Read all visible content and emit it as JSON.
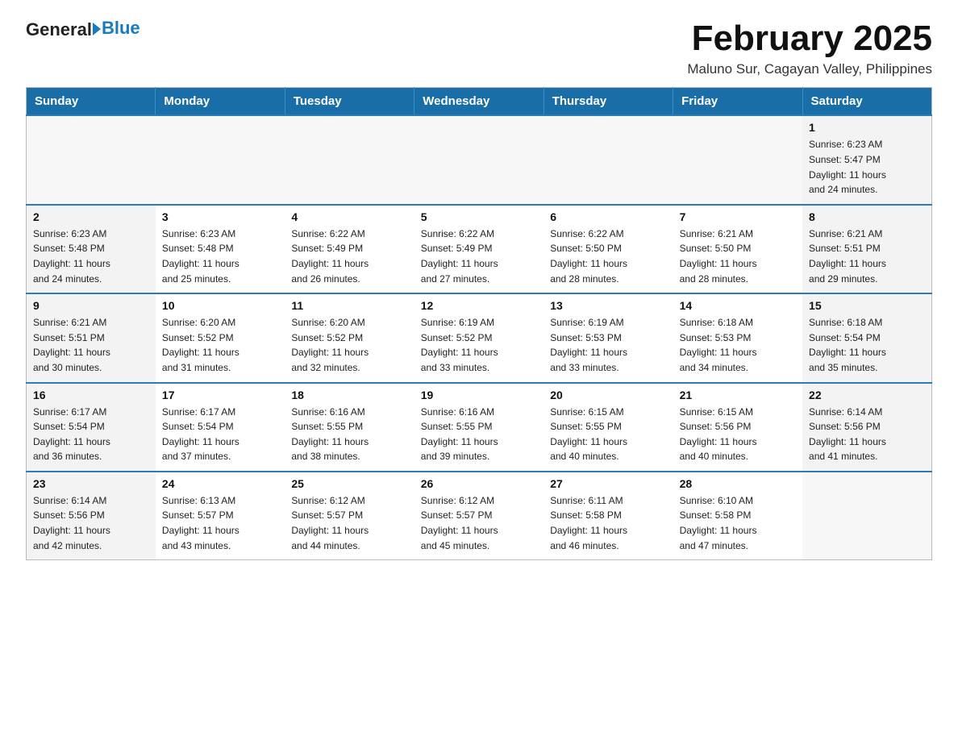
{
  "logo": {
    "text_general": "General",
    "text_blue": "Blue",
    "tagline": "GeneralBlue"
  },
  "header": {
    "month_title": "February 2025",
    "subtitle": "Maluno Sur, Cagayan Valley, Philippines"
  },
  "days_of_week": [
    "Sunday",
    "Monday",
    "Tuesday",
    "Wednesday",
    "Thursday",
    "Friday",
    "Saturday"
  ],
  "weeks": [
    {
      "days": [
        {
          "number": "",
          "info": ""
        },
        {
          "number": "",
          "info": ""
        },
        {
          "number": "",
          "info": ""
        },
        {
          "number": "",
          "info": ""
        },
        {
          "number": "",
          "info": ""
        },
        {
          "number": "",
          "info": ""
        },
        {
          "number": "1",
          "info": "Sunrise: 6:23 AM\nSunset: 5:47 PM\nDaylight: 11 hours\nand 24 minutes."
        }
      ]
    },
    {
      "days": [
        {
          "number": "2",
          "info": "Sunrise: 6:23 AM\nSunset: 5:48 PM\nDaylight: 11 hours\nand 24 minutes."
        },
        {
          "number": "3",
          "info": "Sunrise: 6:23 AM\nSunset: 5:48 PM\nDaylight: 11 hours\nand 25 minutes."
        },
        {
          "number": "4",
          "info": "Sunrise: 6:22 AM\nSunset: 5:49 PM\nDaylight: 11 hours\nand 26 minutes."
        },
        {
          "number": "5",
          "info": "Sunrise: 6:22 AM\nSunset: 5:49 PM\nDaylight: 11 hours\nand 27 minutes."
        },
        {
          "number": "6",
          "info": "Sunrise: 6:22 AM\nSunset: 5:50 PM\nDaylight: 11 hours\nand 28 minutes."
        },
        {
          "number": "7",
          "info": "Sunrise: 6:21 AM\nSunset: 5:50 PM\nDaylight: 11 hours\nand 28 minutes."
        },
        {
          "number": "8",
          "info": "Sunrise: 6:21 AM\nSunset: 5:51 PM\nDaylight: 11 hours\nand 29 minutes."
        }
      ]
    },
    {
      "days": [
        {
          "number": "9",
          "info": "Sunrise: 6:21 AM\nSunset: 5:51 PM\nDaylight: 11 hours\nand 30 minutes."
        },
        {
          "number": "10",
          "info": "Sunrise: 6:20 AM\nSunset: 5:52 PM\nDaylight: 11 hours\nand 31 minutes."
        },
        {
          "number": "11",
          "info": "Sunrise: 6:20 AM\nSunset: 5:52 PM\nDaylight: 11 hours\nand 32 minutes."
        },
        {
          "number": "12",
          "info": "Sunrise: 6:19 AM\nSunset: 5:52 PM\nDaylight: 11 hours\nand 33 minutes."
        },
        {
          "number": "13",
          "info": "Sunrise: 6:19 AM\nSunset: 5:53 PM\nDaylight: 11 hours\nand 33 minutes."
        },
        {
          "number": "14",
          "info": "Sunrise: 6:18 AM\nSunset: 5:53 PM\nDaylight: 11 hours\nand 34 minutes."
        },
        {
          "number": "15",
          "info": "Sunrise: 6:18 AM\nSunset: 5:54 PM\nDaylight: 11 hours\nand 35 minutes."
        }
      ]
    },
    {
      "days": [
        {
          "number": "16",
          "info": "Sunrise: 6:17 AM\nSunset: 5:54 PM\nDaylight: 11 hours\nand 36 minutes."
        },
        {
          "number": "17",
          "info": "Sunrise: 6:17 AM\nSunset: 5:54 PM\nDaylight: 11 hours\nand 37 minutes."
        },
        {
          "number": "18",
          "info": "Sunrise: 6:16 AM\nSunset: 5:55 PM\nDaylight: 11 hours\nand 38 minutes."
        },
        {
          "number": "19",
          "info": "Sunrise: 6:16 AM\nSunset: 5:55 PM\nDaylight: 11 hours\nand 39 minutes."
        },
        {
          "number": "20",
          "info": "Sunrise: 6:15 AM\nSunset: 5:55 PM\nDaylight: 11 hours\nand 40 minutes."
        },
        {
          "number": "21",
          "info": "Sunrise: 6:15 AM\nSunset: 5:56 PM\nDaylight: 11 hours\nand 40 minutes."
        },
        {
          "number": "22",
          "info": "Sunrise: 6:14 AM\nSunset: 5:56 PM\nDaylight: 11 hours\nand 41 minutes."
        }
      ]
    },
    {
      "days": [
        {
          "number": "23",
          "info": "Sunrise: 6:14 AM\nSunset: 5:56 PM\nDaylight: 11 hours\nand 42 minutes."
        },
        {
          "number": "24",
          "info": "Sunrise: 6:13 AM\nSunset: 5:57 PM\nDaylight: 11 hours\nand 43 minutes."
        },
        {
          "number": "25",
          "info": "Sunrise: 6:12 AM\nSunset: 5:57 PM\nDaylight: 11 hours\nand 44 minutes."
        },
        {
          "number": "26",
          "info": "Sunrise: 6:12 AM\nSunset: 5:57 PM\nDaylight: 11 hours\nand 45 minutes."
        },
        {
          "number": "27",
          "info": "Sunrise: 6:11 AM\nSunset: 5:58 PM\nDaylight: 11 hours\nand 46 minutes."
        },
        {
          "number": "28",
          "info": "Sunrise: 6:10 AM\nSunset: 5:58 PM\nDaylight: 11 hours\nand 47 minutes."
        },
        {
          "number": "",
          "info": ""
        }
      ]
    }
  ]
}
